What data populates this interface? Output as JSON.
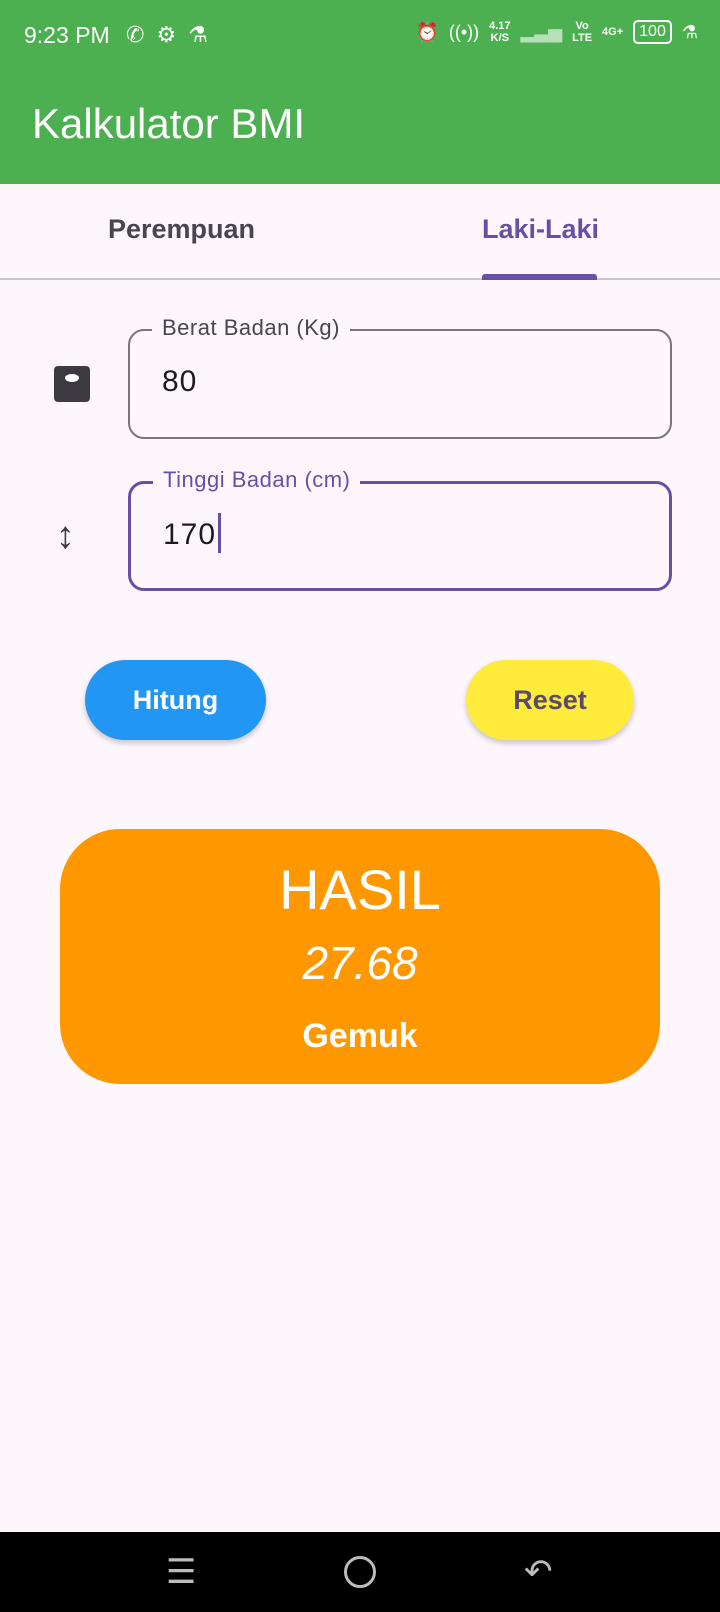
{
  "status_bar": {
    "time": "9:23 PM",
    "network_speed": "4.17",
    "network_unit": "K/S",
    "volte": "Vo\nLTE",
    "signal": "4G+",
    "battery": "100"
  },
  "app_bar": {
    "title": "Kalkulator BMI"
  },
  "tabs": [
    {
      "label": "Perempuan",
      "selected": false
    },
    {
      "label": "Laki-Laki",
      "selected": true
    }
  ],
  "form": {
    "weight": {
      "label": "Berat Badan (Kg)",
      "value": "80",
      "icon": "scale-icon"
    },
    "height": {
      "label": "Tinggi Badan (cm)",
      "value": "170",
      "icon": "height-icon",
      "focused": true
    }
  },
  "buttons": {
    "calculate": "Hitung",
    "reset": "Reset"
  },
  "result": {
    "title": "HASIL",
    "value": "27.68",
    "category": "Gemuk"
  },
  "colors": {
    "app_bar": "#4caf50",
    "accent": "#6750a4",
    "calculate_button": "#2196f3",
    "reset_button": "#ffeb3b",
    "result_card": "#ff9800"
  }
}
